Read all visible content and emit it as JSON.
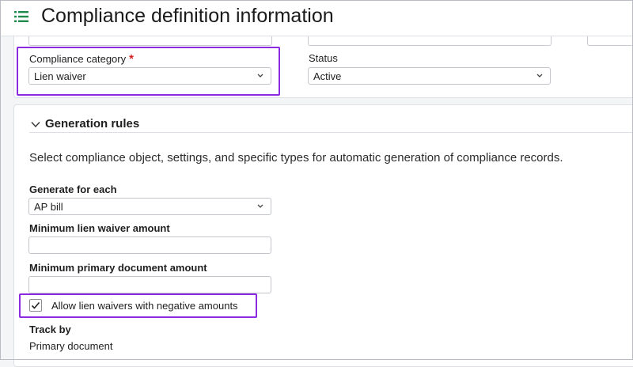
{
  "header": {
    "title": "Compliance definition information",
    "menu_icon": "list-icon"
  },
  "compliance_category": {
    "label": "Compliance category",
    "required_mark": "*",
    "value": "Lien waiver"
  },
  "status": {
    "label": "Status",
    "value": "Active"
  },
  "generation_rules": {
    "title": "Generation rules",
    "description": "Select compliance object, settings, and specific types for automatic generation of compliance records.",
    "generate_for_each": {
      "label": "Generate for each",
      "value": "AP bill"
    },
    "min_lien_waiver_amount": {
      "label": "Minimum lien waiver amount",
      "value": ""
    },
    "min_primary_doc_amount": {
      "label": "Minimum primary document amount",
      "value": ""
    },
    "allow_negative": {
      "label": "Allow lien waivers with negative amounts",
      "checked": true
    },
    "track_by": {
      "label": "Track by",
      "value": "Primary document"
    }
  },
  "colors": {
    "accent_green": "#1f8a4c",
    "highlight_purple": "#8a2be2",
    "required_red": "#d41f1f"
  }
}
